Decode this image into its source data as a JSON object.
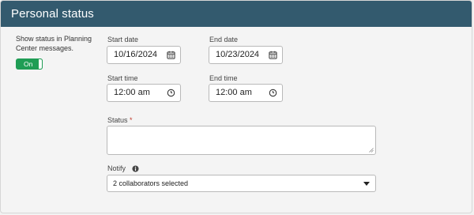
{
  "header": {
    "title": "Personal status"
  },
  "visibility": {
    "description": "Show status in Planning Center messages.",
    "toggle_label": "On",
    "toggle_on": true
  },
  "start_date": {
    "label": "Start date",
    "value": "10/16/2024",
    "icon": "calendar-icon"
  },
  "end_date": {
    "label": "End date",
    "value": "10/23/2024",
    "icon": "calendar-icon"
  },
  "start_time": {
    "label": "Start time",
    "value": "12:00 am",
    "icon": "clock-icon"
  },
  "end_time": {
    "label": "End time",
    "value": "12:00 am",
    "icon": "clock-icon"
  },
  "status": {
    "label": "Status",
    "required_marker": "*",
    "value": ""
  },
  "notify": {
    "label": "Notify",
    "info_icon": "info-icon",
    "selected": "2 collaborators selected"
  },
  "colors": {
    "header_bg": "#335a6e",
    "toggle_on": "#1f9d55",
    "required": "#c0392b"
  }
}
